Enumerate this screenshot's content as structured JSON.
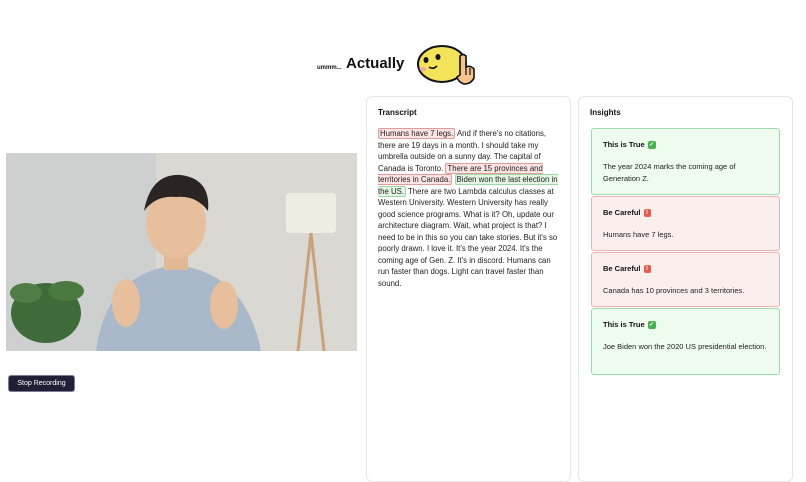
{
  "header": {
    "prefix": "ummm...",
    "title": "Actually"
  },
  "controls": {
    "stop_label": "Stop Recording"
  },
  "transcript": {
    "title": "Transcript",
    "segments": [
      {
        "text": "Humans have 7 legs.",
        "status": "false"
      },
      {
        "text": " And if there's no citations, there are 19 days in a month. I should take my umbrella outside on a sunny day. The capital of Canada is Toronto. ",
        "status": "none"
      },
      {
        "text": "There are 15 provinces and territories in Canada.",
        "status": "false"
      },
      {
        "text": " ",
        "status": "none"
      },
      {
        "text": "Biden won the last election in the US.",
        "status": "true"
      },
      {
        "text": " There are two Lambda calculus classes at Western University. Western University has really good science programs. What is it? Oh, update our architecture diagram. Wait, what project is that? I need to be in this so you can take stories. But it's so poorly drawn. I love it. It's the year 2024. It's the coming age of Gen. Z. It's in discord. Humans can run faster than dogs. Light can travel faster than sound.",
        "status": "none"
      }
    ]
  },
  "insights": {
    "title": "Insights",
    "cards": [
      {
        "title": "This is True",
        "status": "true",
        "body": "The year 2024 marks the coming age of Generation Z."
      },
      {
        "title": "Be Careful",
        "status": "false",
        "body": "Humans have 7 legs."
      },
      {
        "title": "Be Careful",
        "status": "false",
        "body": "Canada has 10 provinces and 3 territories."
      },
      {
        "title": "This is True",
        "status": "true",
        "body": "Joe Biden won the 2020 US presidential election."
      }
    ]
  },
  "colors": {
    "true_bg": "#eefbef",
    "true_border": "#9cdca6",
    "false_bg": "#fdeeee",
    "false_border": "#eab2b2",
    "button_bg": "#1f1f35"
  }
}
